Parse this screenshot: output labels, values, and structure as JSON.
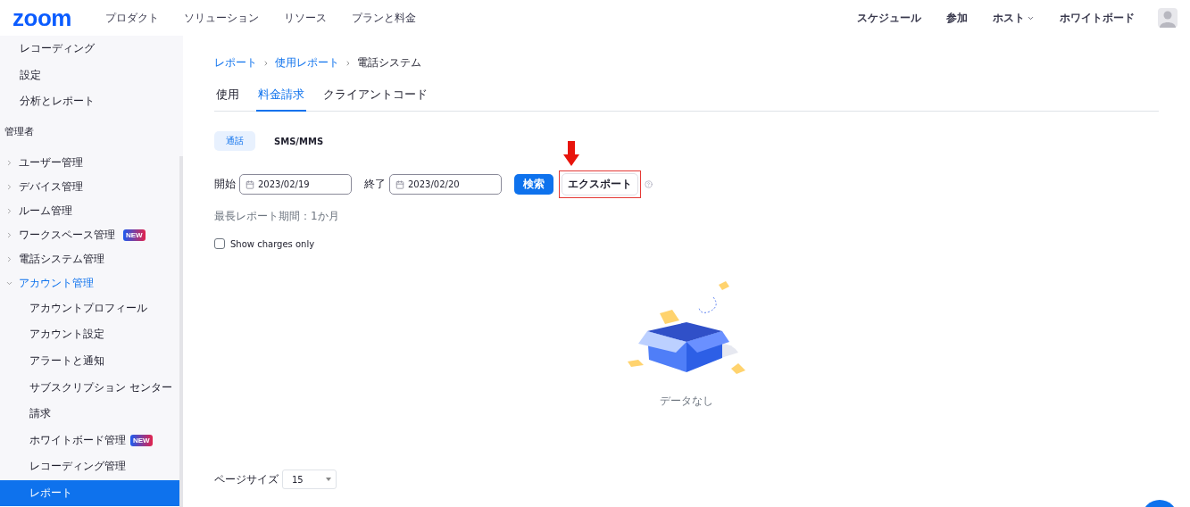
{
  "header": {
    "logo": "zoom",
    "nav": [
      {
        "label": "プロダクト"
      },
      {
        "label": "ソリューション"
      },
      {
        "label": "リソース"
      },
      {
        "label": "プランと料金"
      }
    ],
    "right_nav": [
      {
        "label": "スケジュール",
        "dropdown": false
      },
      {
        "label": "参加",
        "dropdown": false
      },
      {
        "label": "ホスト",
        "dropdown": true
      },
      {
        "label": "ホワイトボード",
        "dropdown": false
      }
    ]
  },
  "sidebar": {
    "top_items": [
      {
        "label": "レコーディング",
        "selected": false
      },
      {
        "label": "設定",
        "selected": false
      },
      {
        "label": "分析とレポート",
        "selected": false
      }
    ],
    "section_title": "管理者",
    "groups": [
      {
        "label": "ユーザー管理",
        "expanded": false
      },
      {
        "label": "デバイス管理",
        "expanded": false
      },
      {
        "label": "ルーム管理",
        "expanded": false
      },
      {
        "label": "ワークスペース管理",
        "expanded": false,
        "badge": "NEW"
      },
      {
        "label": "電話システム管理",
        "expanded": false
      },
      {
        "label": "アカウント管理",
        "expanded": true,
        "children": [
          {
            "label": "アカウントプロフィール",
            "selected": false
          },
          {
            "label": "アカウント設定",
            "selected": false
          },
          {
            "label": "アラートと通知",
            "selected": false
          },
          {
            "label": "サブスクリプション センター",
            "selected": false
          },
          {
            "label": "請求",
            "selected": false
          },
          {
            "label": "ホワイトボード管理",
            "selected": false,
            "badge": "NEW"
          },
          {
            "label": "レコーディング管理",
            "selected": false
          },
          {
            "label": "レポート",
            "selected": true
          }
        ]
      }
    ]
  },
  "main": {
    "breadcrumb": [
      {
        "label": "レポート",
        "link": true
      },
      {
        "label": "使用レポート",
        "link": true
      },
      {
        "label": "電話システム",
        "link": false
      }
    ],
    "tabs": [
      {
        "label": "使用",
        "selected": false
      },
      {
        "label": "料金請求",
        "selected": true
      },
      {
        "label": "クライアントコード",
        "selected": false
      }
    ],
    "subtabs": [
      {
        "label": "通話",
        "selected": true
      },
      {
        "label": "SMS/MMS",
        "selected": false
      }
    ],
    "filter": {
      "start_label": "開始",
      "start_value": "2023/02/19",
      "end_label": "終了",
      "end_value": "2023/02/20",
      "search_button": "検索",
      "export_button": {
        "label": "エクスポート",
        "highlighted": true
      }
    },
    "note": "最長レポート期間：1か月",
    "checkbox": {
      "label": "Show charges only",
      "checked": false
    },
    "empty_text": "データなし",
    "page_size": {
      "label": "ページサイズ",
      "value": "15"
    }
  }
}
